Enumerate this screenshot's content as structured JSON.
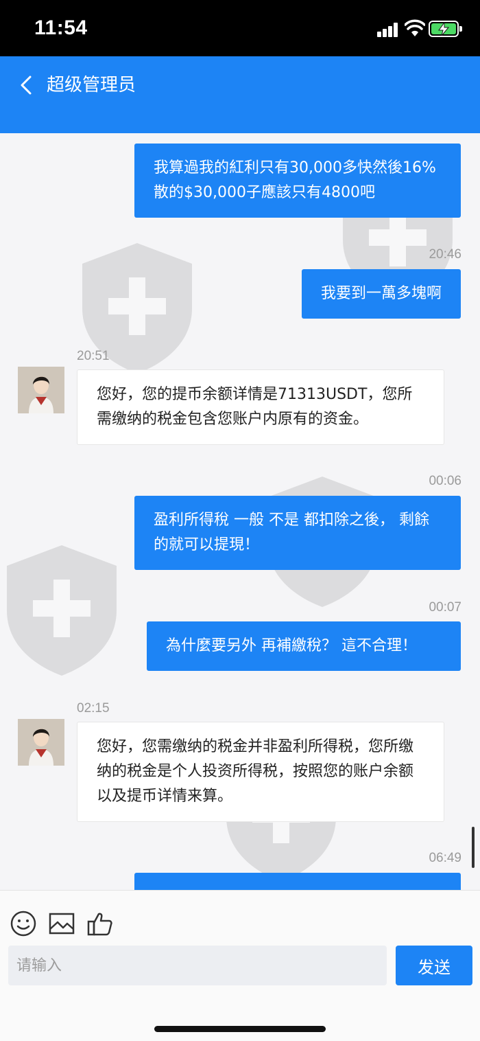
{
  "status_bar": {
    "time": "11:54"
  },
  "header": {
    "title": "超级管理员"
  },
  "messages": [
    {
      "time": "",
      "text": "我算過我的紅利只有30,000多快然後16%散的$30,000子應該只有4800吧"
    },
    {
      "time": "20:46",
      "text": "我要到一萬多塊啊"
    },
    {
      "time": "20:51",
      "text": "您好，您的提币余额详情是71313USDT，您所需缴纳的税金包含您账户内原有的资金。"
    },
    {
      "time": "00:06",
      "text": "盈利所得稅 一般 不是 都扣除之後， 剩餘的就可以提現！"
    },
    {
      "time": "00:07",
      "text": "為什麼要另外 再補繳稅？ 這不合理！"
    },
    {
      "time": "02:15",
      "text": "您好，您需缴纳的税金并非盈利所得税，您所缴纳的税金是个人投资所得税，按照您的账户余额以及提币详情来算。"
    },
    {
      "time": "06:49",
      "text": ""
    }
  ],
  "input": {
    "placeholder": "请输入",
    "send_label": "发送"
  },
  "icons": {
    "emoji": "emoji-icon",
    "image": "image-icon",
    "like": "thumbs-up-icon",
    "back": "back-chevron-icon"
  },
  "colors": {
    "accent": "#1d84f5",
    "status_bar": "#000000",
    "battery": "#4cd964"
  }
}
